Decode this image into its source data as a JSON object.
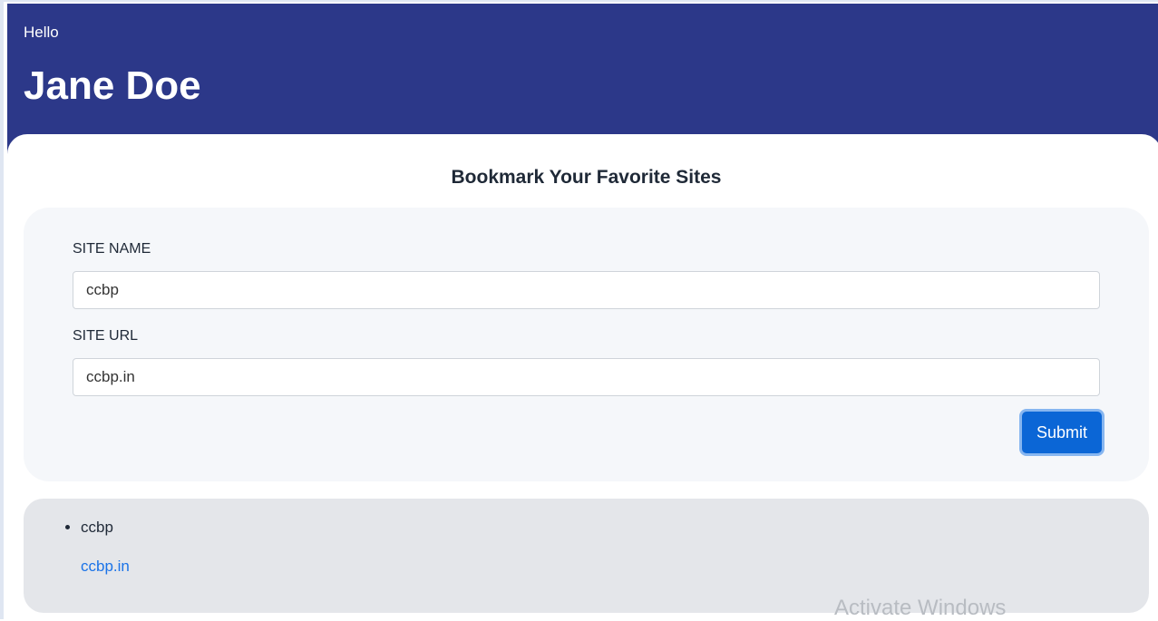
{
  "header": {
    "greeting": "Hello",
    "name": "Jane Doe"
  },
  "main": {
    "title": "Bookmark Your Favorite Sites",
    "form": {
      "site_name_label": "SITE NAME",
      "site_name_value": "ccbp",
      "site_url_label": "SITE URL",
      "site_url_value": "ccbp.in",
      "submit_label": "Submit"
    },
    "bookmarks": [
      {
        "name": "ccbp",
        "url": "ccbp.in"
      }
    ]
  },
  "overlay": {
    "watermark": "Activate Windows"
  },
  "colors": {
    "header_bg": "#2c3889",
    "primary_button": "#0b66d6",
    "link": "#1a73e8",
    "form_panel_bg": "#f5f7fa",
    "list_panel_bg": "#e4e6ea"
  }
}
